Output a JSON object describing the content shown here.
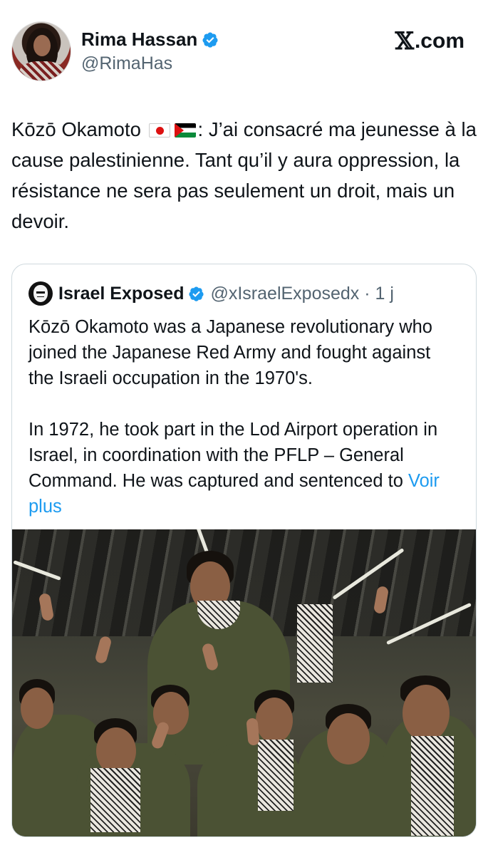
{
  "author": {
    "display_name": "Rima Hassan",
    "handle": "@RimaHas",
    "avatar_icon": "profile-photo"
  },
  "source": {
    "label": ".com",
    "logo": "x-logo"
  },
  "tweet": {
    "text_before_flags": "Kōzō Okamoto",
    "flags": [
      "japan-flag",
      "palestine-flag"
    ],
    "text_after_flags": ": J’ai consacré ma jeunesse à la cause palestinienne. Tant qu’il y aura oppression, la résistance ne sera pas seulement un droit, mais un devoir."
  },
  "quoted": {
    "display_name": "Israel Exposed",
    "handle_time": "@xIsraelExposedx · 1 j",
    "paragraph_1": "Kōzō Okamoto was a Japanese revolutionary who joined the Japanese Red Army and fought against the Israeli occupation in the 1970's.",
    "paragraph_2": "In 1972, he took part in the Lod Airport operation in Israel, in coordination with the PFLP – General Command. He was captured and sentenced to ",
    "see_more": "Voir plus",
    "photo_description_icon": "group-photo"
  },
  "colors": {
    "text": "#0f1419",
    "secondary": "#536471",
    "link": "#1d9bf0",
    "border": "#cfd9de",
    "verified": "#1d9bf0"
  }
}
